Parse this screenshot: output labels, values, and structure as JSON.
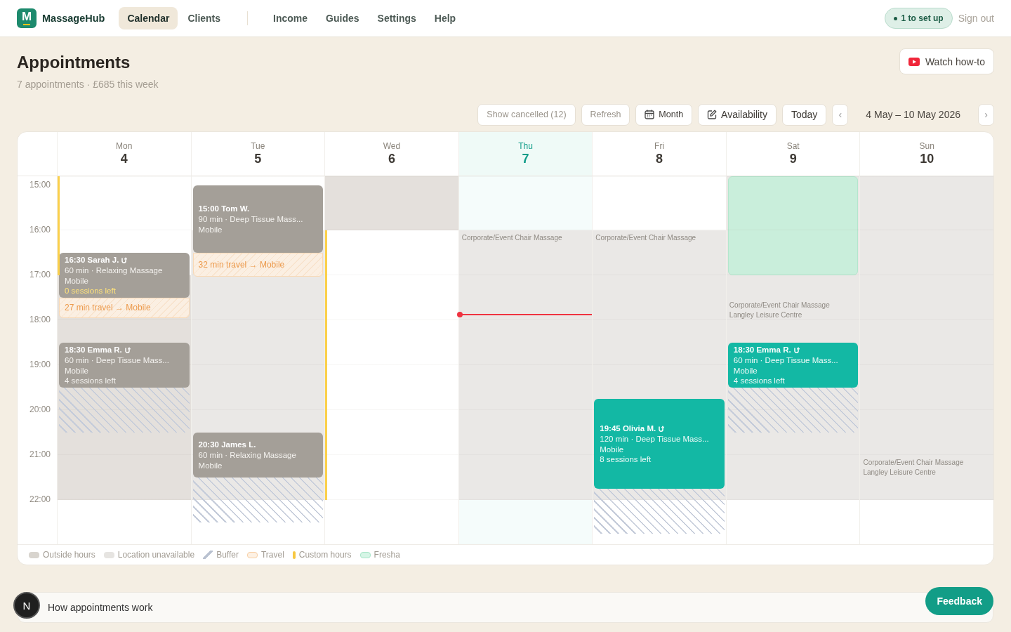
{
  "app": {
    "logo_letter": "M",
    "name": "MassageHub"
  },
  "nav_primary": [
    {
      "label": "Calendar",
      "selected": true
    },
    {
      "label": "Clients",
      "selected": false
    }
  ],
  "nav_secondary": [
    {
      "label": "Income",
      "selected": false
    },
    {
      "label": "Guides",
      "selected": false
    },
    {
      "label": "Settings",
      "selected": false
    },
    {
      "label": "Help",
      "selected": false
    }
  ],
  "setup_badge": "1 to set up",
  "sign_out": "Sign out",
  "page": {
    "title": "Appointments",
    "subtitle": "7 appointments · £685 this week",
    "video_button": "Watch how-to"
  },
  "toolbar": [
    {
      "label": "Show cancelled (12)",
      "kind": "muted"
    },
    {
      "label": "Refresh",
      "kind": "muted"
    },
    {
      "label": "Month",
      "kind": "calendar"
    },
    {
      "label": "Availability",
      "kind": "edit"
    },
    {
      "label": "Today",
      "kind": "plain"
    }
  ],
  "range": {
    "prev": "‹",
    "label": "4 May – 10 May 2026",
    "next": "›"
  },
  "hours": [
    "15:00",
    "16:00",
    "17:00",
    "18:00",
    "19:00",
    "20:00",
    "21:00",
    "22:00"
  ],
  "days": [
    {
      "weekday": "Mon",
      "date": "4",
      "today": false,
      "background": [
        {
          "kind": "custom"
        },
        {
          "kind": "outside"
        }
      ],
      "events": [
        {
          "kind": "appointment",
          "title": "16:30 Sarah J.",
          "recurring": true,
          "past": true,
          "details": "60 min · Relaxing Massage",
          "location": "Mobile",
          "sessions": {
            "text": "0 sessions left",
            "low": true
          }
        },
        {
          "kind": "travel",
          "text": "27 min travel → Mobile"
        },
        {
          "kind": "appointment",
          "title": "18:30 Emma R.",
          "recurring": true,
          "past": true,
          "details": "60 min · Deep Tissue Mass...",
          "location": "Mobile",
          "sessions": {
            "text": "4 sessions left",
            "low": false
          }
        },
        {
          "kind": "buffer"
        }
      ]
    },
    {
      "weekday": "Tue",
      "date": "5",
      "today": false,
      "background": [
        {
          "kind": "unavailable"
        }
      ],
      "events": [
        {
          "kind": "appointment",
          "title": "15:00 Tom W.",
          "recurring": false,
          "past": true,
          "details": "90 min · Deep Tissue Mass...",
          "location": "Mobile"
        },
        {
          "kind": "travel",
          "text": "32 min travel → Mobile"
        },
        {
          "kind": "appointment",
          "title": "20:30 James L.",
          "recurring": false,
          "past": true,
          "details": "60 min · Relaxing Massage",
          "location": "Mobile"
        },
        {
          "kind": "buffer"
        }
      ]
    },
    {
      "weekday": "Wed",
      "date": "6",
      "today": false,
      "background": [
        {
          "kind": "outside"
        },
        {
          "kind": "custom"
        }
      ]
    },
    {
      "weekday": "Thu",
      "date": "7",
      "today": true,
      "now_line": true,
      "background": [
        {
          "kind": "unavailable",
          "label": [
            "Corporate/Event Chair Massage"
          ]
        }
      ]
    },
    {
      "weekday": "Fri",
      "date": "8",
      "today": false,
      "background": [
        {
          "kind": "unavailable",
          "label": [
            "Corporate/Event Chair Massage"
          ]
        }
      ],
      "events": [
        {
          "kind": "appointment",
          "title": "19:45 Olivia M.",
          "recurring": true,
          "past": false,
          "details": "120 min · Deep Tissue Mass...",
          "location": "Mobile",
          "sessions": {
            "text": "8 sessions left",
            "low": false
          }
        },
        {
          "kind": "buffer"
        }
      ]
    },
    {
      "weekday": "Sat",
      "date": "9",
      "today": false,
      "background": [
        {
          "kind": "unavailable"
        },
        {
          "kind": "fresha"
        },
        {
          "kind": "unavailable",
          "label": [
            "Corporate/Event Chair Massage",
            "Langley Leisure Centre"
          ]
        }
      ],
      "events": [
        {
          "kind": "appointment",
          "title": "18:30 Emma R.",
          "recurring": true,
          "past": false,
          "details": "60 min · Deep Tissue Mass...",
          "location": "Mobile",
          "sessions": {
            "text": "4 sessions left",
            "low": false
          }
        },
        {
          "kind": "buffer"
        }
      ]
    },
    {
      "weekday": "Sun",
      "date": "10",
      "today": false,
      "background": [
        {
          "kind": "unavailable"
        },
        {
          "kind": "unavailable",
          "label": [
            "Corporate/Event Chair Massage",
            "Langley Leisure Centre"
          ]
        }
      ]
    }
  ],
  "legend": [
    {
      "label": "Outside hours",
      "kind": "outside"
    },
    {
      "label": "Location unavailable",
      "kind": "unavailable"
    },
    {
      "label": "Buffer",
      "kind": "buffer"
    },
    {
      "label": "Travel",
      "kind": "travel"
    },
    {
      "label": "Custom hours",
      "kind": "custom"
    },
    {
      "label": "Fresha",
      "kind": "fresha"
    }
  ],
  "help_panel": "How appointments work",
  "dev_badge": "N",
  "feedback_button": "Feedback"
}
